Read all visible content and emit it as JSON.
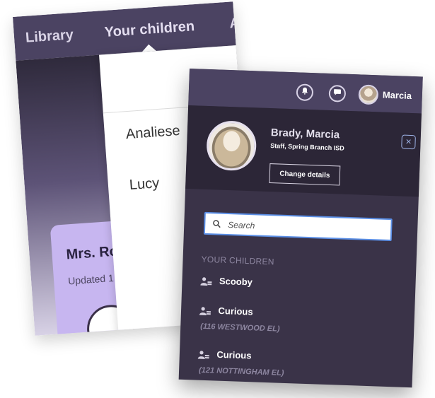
{
  "back_panel": {
    "nav": {
      "library": "Library",
      "your_children": "Your children",
      "more_partial": "A"
    },
    "dropdown_items": [
      "Analiese",
      "Lucy"
    ],
    "teacher_card": {
      "name_partial": "Mrs. Ro",
      "updated_partial": "Updated 1"
    }
  },
  "front_panel": {
    "top_bar": {
      "bell_icon": "bell-icon",
      "chat_icon": "chat-icon",
      "user_name": "Marcia"
    },
    "profile": {
      "name": "Brady, Marcia",
      "role": "Staff, Spring Branch ISD",
      "change_details_label": "Change details",
      "close_icon": "close-icon"
    },
    "search": {
      "placeholder": "Search"
    },
    "children_section_label": "YOUR CHILDREN",
    "children": [
      {
        "name": "Scooby",
        "school": ""
      },
      {
        "name": "Curious",
        "school": "(116 WESTWOOD EL)"
      },
      {
        "name": "Curious",
        "school": "(121 NOTTINGHAM EL)"
      }
    ]
  },
  "colors": {
    "nav_bg": "#4b4362",
    "panel_bg": "#3a3348",
    "profile_bg": "#2c2637",
    "search_border": "#5b8fe6",
    "card_lavender": "#c7b6f0",
    "muted_text": "#8d86a0"
  }
}
